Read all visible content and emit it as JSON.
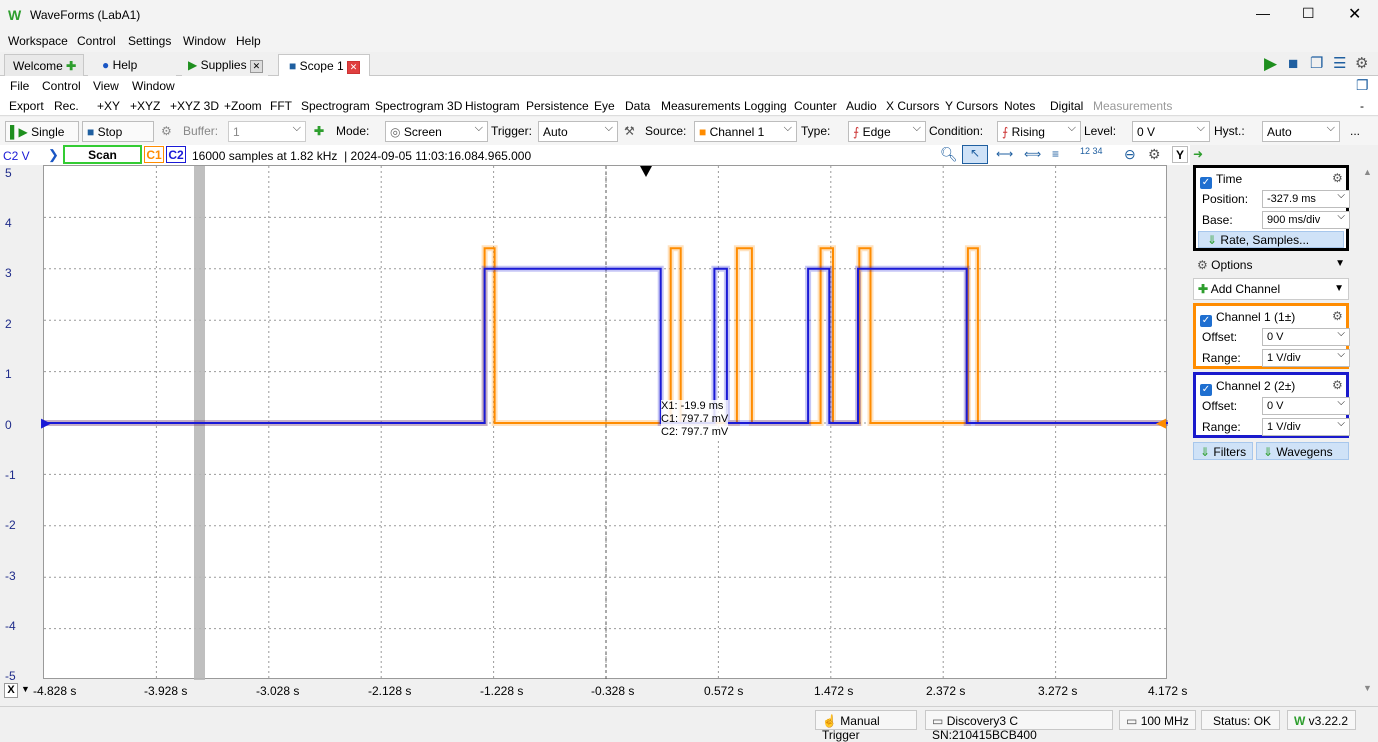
{
  "window": {
    "title": "WaveForms (LabA1)"
  },
  "menu": [
    "Workspace",
    "Control",
    "Settings",
    "Window",
    "Help"
  ],
  "tabs": [
    {
      "label": "Welcome"
    },
    {
      "label": "Help"
    },
    {
      "label": "Supplies"
    },
    {
      "label": "Scope 1"
    }
  ],
  "submenu": [
    "File",
    "Control",
    "View",
    "Window"
  ],
  "toolbar": [
    "Export",
    "Rec.",
    "+XY",
    "+XYZ",
    "+XYZ 3D",
    "+Zoom",
    "FFT",
    "Spectrogram",
    "Spectrogram 3D",
    "Histogram",
    "Persistence",
    "Eye",
    "Data",
    "Measurements",
    "Logging",
    "Counter",
    "Audio",
    "X Cursors",
    "Y Cursors",
    "Notes",
    "Digital",
    "Measurements",
    "-"
  ],
  "controls": {
    "single": "Single",
    "stop": "Stop",
    "buffer_label": "Buffer:",
    "buffer_value": "1",
    "mode_label": "Mode:",
    "mode_value": "Screen",
    "trigger_label": "Trigger:",
    "trigger_value": "Auto",
    "source_label": "Source:",
    "source_value": "Channel 1",
    "type_label": "Type:",
    "type_value": "Edge",
    "condition_label": "Condition:",
    "condition_value": "Rising",
    "level_label": "Level:",
    "level_value": "0 V",
    "hyst_label": "Hyst.:",
    "hyst_value": "Auto",
    "more": "..."
  },
  "info": {
    "channel": "C2 V",
    "scan": "Scan",
    "c1": "C1",
    "c2": "C2",
    "status": "16000 samples at 1.82 kHz  | 2024-09-05 11:03:16.084.965.000",
    "y_btn": "Y"
  },
  "cursor": {
    "x1": "X1: -19.9 ms",
    "c1": "C1: 797.7 mV",
    "c2": "C2: 797.7 mV"
  },
  "y_ticks": [
    "5",
    "4",
    "3",
    "2",
    "1",
    "0",
    "-1",
    "-2",
    "-3",
    "-4",
    "-5"
  ],
  "x_ticks": [
    "-4.828 s",
    "-3.928 s",
    "-3.028 s",
    "-2.128 s",
    "-1.228 s",
    "-0.328 s",
    "0.572 s",
    "1.472 s",
    "2.372 s",
    "3.272 s",
    "4.172 s"
  ],
  "x_btn": "X",
  "time_panel": {
    "title": "Time",
    "position_label": "Position:",
    "position_value": "-327.9 ms",
    "base_label": "Base:",
    "base_value": "900 ms/div",
    "rate": "Rate, Samples..."
  },
  "options": "Options",
  "add_channel": "Add Channel",
  "ch1": {
    "title": "Channel 1 (1±)",
    "offset_label": "Offset:",
    "offset_value": "0 V",
    "range_label": "Range:",
    "range_value": "1 V/div"
  },
  "ch2": {
    "title": "Channel 2 (2±)",
    "offset_label": "Offset:",
    "offset_value": "0 V",
    "range_label": "Range:",
    "range_value": "1 V/div"
  },
  "filters": "Filters",
  "wavegens": "Wavegens",
  "status": {
    "manual_trigger": "Manual Trigger",
    "device": "Discovery3 C SN:210415BCB400",
    "freq": "100 MHz",
    "status": "Status: OK",
    "version": "v3.22.2"
  },
  "colors": {
    "ch1": "#ff8c00",
    "ch2": "#1a1ad6",
    "time_border": "#000000",
    "ch1_border": "#ff8c00",
    "ch2_border": "#1a1acc",
    "scan_border": "#33cc33"
  },
  "chart_data": {
    "type": "line",
    "x_unit": "s",
    "y_unit": "V",
    "xlim": [
      -4.828,
      4.172
    ],
    "ylim": [
      -5,
      5
    ],
    "series": [
      {
        "name": "C1",
        "x": [
          -4.828,
          -1.3,
          -1.3,
          -1.22,
          -1.22,
          0.19,
          0.19,
          0.27,
          0.27,
          0.72,
          0.72,
          0.84,
          0.84,
          1.39,
          1.39,
          1.49,
          1.49,
          1.7,
          1.7,
          1.79,
          1.79,
          2.57,
          2.57,
          2.65,
          2.65,
          4.172
        ],
        "y": [
          0,
          0,
          3.4,
          3.4,
          0,
          0,
          3.4,
          3.4,
          0,
          0,
          3.4,
          3.4,
          0,
          0,
          3.4,
          3.4,
          0,
          0,
          3.4,
          3.4,
          0,
          0,
          3.4,
          3.4,
          0,
          0
        ]
      },
      {
        "name": "C2",
        "x": [
          -4.828,
          -1.3,
          -1.3,
          0.11,
          0.11,
          0.19,
          0.19,
          0.54,
          0.54,
          0.64,
          0.64,
          0.82,
          0.82,
          1.29,
          1.29,
          1.46,
          1.46,
          1.64,
          1.64,
          1.69,
          1.69,
          2.56,
          2.56,
          4.172
        ],
        "y": [
          0,
          0,
          3.0,
          3.0,
          0,
          0,
          0,
          0,
          3.0,
          3.0,
          0,
          0,
          0,
          0,
          3.0,
          3.0,
          0,
          0,
          0,
          0,
          3.0,
          3.0,
          0,
          0
        ]
      }
    ]
  }
}
